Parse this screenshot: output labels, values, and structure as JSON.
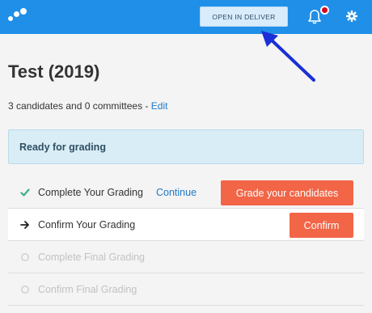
{
  "header": {
    "open_button_label": "OPEN IN DELIVER",
    "icons": [
      "logo-icon",
      "bell-icon",
      "gear-icon"
    ],
    "notification_dot": true
  },
  "page": {
    "title": "Test (2019)",
    "summary": "3 candidates and 0 committees - ",
    "edit_label": "Edit"
  },
  "status": {
    "label": "Ready for grading"
  },
  "steps": [
    {
      "label": "Complete Your Grading",
      "link": "Continue",
      "button": "Grade your candidates",
      "state": "done"
    },
    {
      "label": "Confirm Your Grading",
      "button": "Confirm",
      "state": "current"
    },
    {
      "label": "Complete Final Grading",
      "state": "pending"
    },
    {
      "label": "Confirm Final Grading",
      "state": "pending"
    }
  ],
  "colors": {
    "topbar": "#1f8fe8",
    "accent_orange": "#f26546",
    "link_blue": "#1f78c8",
    "check_green": "#3fae8c",
    "annotation_arrow": "#1a2fd6"
  }
}
